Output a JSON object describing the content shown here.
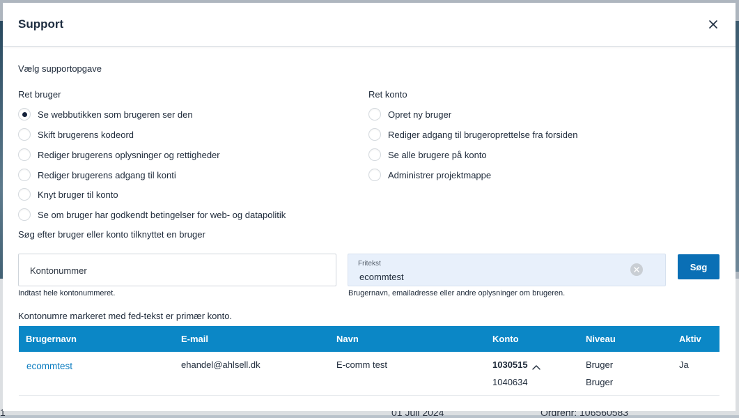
{
  "backdrop": {
    "peek_left": "1",
    "peek_date": "01 Juli 2024",
    "peek_order": "Ordrenr: 106560583"
  },
  "modal": {
    "title": "Support",
    "close_label": "Luk"
  },
  "task": {
    "heading": "Vælg supportopgave",
    "user_column": {
      "title": "Ret bruger",
      "options": [
        {
          "label": "Se webbutikken som brugeren ser den",
          "checked": true
        },
        {
          "label": "Skift brugerens kodeord",
          "checked": false
        },
        {
          "label": "Rediger brugerens oplysninger og rettigheder",
          "checked": false
        },
        {
          "label": "Rediger brugerens adgang til konti",
          "checked": false
        },
        {
          "label": "Knyt bruger til konto",
          "checked": false
        },
        {
          "label": "Se om bruger har godkendt betingelser for web- og datapolitik",
          "checked": false
        }
      ]
    },
    "account_column": {
      "title": "Ret konto",
      "options": [
        {
          "label": "Opret ny bruger",
          "checked": false
        },
        {
          "label": "Rediger adgang til brugeroprettelse fra forsiden",
          "checked": false
        },
        {
          "label": "Se alle brugere på konto",
          "checked": false
        },
        {
          "label": "Administrer projektmappe",
          "checked": false
        }
      ]
    }
  },
  "search": {
    "heading": "Søg efter bruger eller konto tilknyttet en bruger",
    "account_input": {
      "placeholder": "Kontonummer",
      "value": "",
      "helper": "Indtast hele kontonummeret."
    },
    "free_input": {
      "label": "Fritekst",
      "value": "ecommtest",
      "helper": "Brugernavn, emailadresse eller andre oplysninger om brugeren."
    },
    "button_label": "Søg"
  },
  "results": {
    "note": "Kontonumre markeret med fed-tekst er primær konto.",
    "columns": [
      "Brugernavn",
      "E-mail",
      "Navn",
      "Konto",
      "Niveau",
      "Aktiv"
    ],
    "rows": [
      {
        "username": "ecommtest",
        "email": "ehandel@ahlsell.dk",
        "name": "E-comm test",
        "accounts": [
          {
            "number": "1030515",
            "primary": true,
            "level": "Bruger"
          },
          {
            "number": "1040634",
            "primary": false,
            "level": "Bruger"
          }
        ],
        "active": "Ja"
      }
    ]
  },
  "colors": {
    "header_blue": "#0b87c6",
    "button_blue": "#0a6fb5",
    "link_blue": "#0b7cc0",
    "input_highlight": "#e8f0fb"
  },
  "icons": {
    "close": "close-icon",
    "clear": "clear-icon",
    "caret": "chevron-up-icon"
  }
}
